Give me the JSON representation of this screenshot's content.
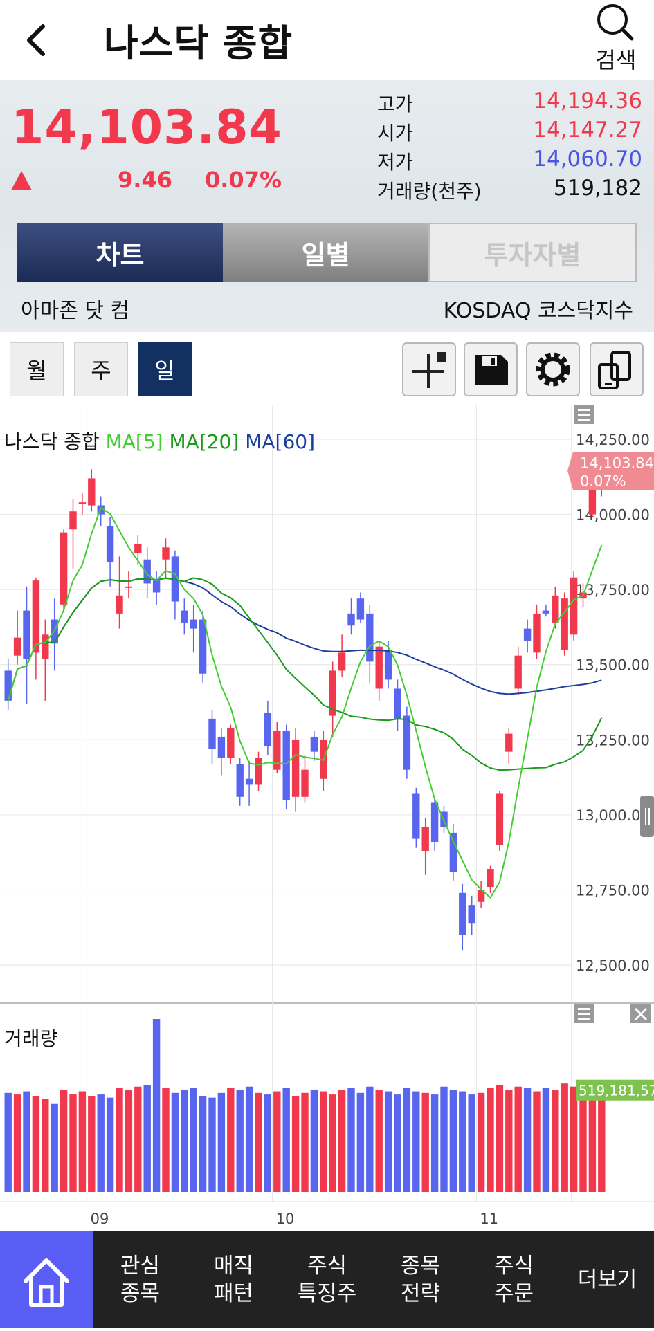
{
  "header": {
    "title": "나스닥 종합",
    "search_label": "검색"
  },
  "quote": {
    "price": "14,103.84",
    "change": "9.46",
    "change_rate": "0.07%",
    "high_label": "고가",
    "high": "14,194.36",
    "open_label": "시가",
    "open": "14,147.27",
    "low_label": "저가",
    "low": "14,060.70",
    "volume_label": "거래량(천주)",
    "volume": "519,182"
  },
  "tabs": [
    {
      "label": "차트"
    },
    {
      "label": "일별"
    },
    {
      "label": "투자자별"
    }
  ],
  "info": {
    "company": "아마존 닷 컴",
    "market": "KOSDAQ 코스닥지수"
  },
  "period_buttons": [
    {
      "label": "월"
    },
    {
      "label": "주"
    },
    {
      "label": "일",
      "active": true
    }
  ],
  "tool_icons": [
    "crosshair-icon",
    "save-icon",
    "gear-icon",
    "rotate-screen-icon"
  ],
  "chart_data": {
    "type": "candlestick",
    "legend": {
      "name": "나스닥 종합",
      "ma": [
        {
          "label": "MA[5]",
          "color": "#44cc33"
        },
        {
          "label": "MA[20]",
          "color": "#1a9a1a"
        },
        {
          "label": "MA[60]",
          "color": "#1a3f9e"
        }
      ]
    },
    "y_ticks": [
      "14,250.00",
      "14,000.00",
      "13,750.00",
      "13,500.00",
      "13,250.00",
      "13,000.00",
      "12,750.00",
      "12,500.00"
    ],
    "y_tick_values": [
      14250,
      14000,
      13750,
      13500,
      13250,
      13000,
      12750,
      12500
    ],
    "ylim": [
      12450,
      14400
    ],
    "x_labels": [
      {
        "label": "09",
        "index": 9
      },
      {
        "label": "10",
        "index": 29
      },
      {
        "label": "11",
        "index": 51
      }
    ],
    "current_price_label": "14,103.84",
    "current_rate_label": "0.07%",
    "up_color": "#f2384c",
    "down_color": "#5865ef",
    "candles": [
      [
        13480,
        13380,
        13520,
        13350
      ],
      [
        13530,
        13590,
        13680,
        13500
      ],
      [
        13680,
        13520,
        13760,
        13370
      ],
      [
        13540,
        13780,
        13790,
        13450
      ],
      [
        13520,
        13600,
        13650,
        13380
      ],
      [
        13650,
        13570,
        13720,
        13480
      ],
      [
        13700,
        13940,
        13950,
        13680
      ],
      [
        13950,
        14010,
        14050,
        13820
      ],
      [
        14040,
        14040,
        14070,
        14000
      ],
      [
        14030,
        14120,
        14150,
        14010
      ],
      [
        14030,
        14000,
        14060,
        13960
      ],
      [
        13960,
        13840,
        13990,
        13760
      ],
      [
        13670,
        13730,
        13860,
        13620
      ],
      [
        13760,
        13760,
        13810,
        13720
      ],
      [
        13870,
        13900,
        13930,
        13830
      ],
      [
        13850,
        13770,
        13890,
        13720
      ],
      [
        13780,
        13740,
        13810,
        13700
      ],
      [
        13850,
        13890,
        13920,
        13790
      ],
      [
        13860,
        13710,
        13880,
        13650
      ],
      [
        13680,
        13640,
        13720,
        13600
      ],
      [
        13650,
        13620,
        13700,
        13540
      ],
      [
        13650,
        13470,
        13680,
        13440
      ],
      [
        13320,
        13220,
        13350,
        13170
      ],
      [
        13260,
        13190,
        13290,
        13130
      ],
      [
        13190,
        13290,
        13300,
        13170
      ],
      [
        13170,
        13060,
        13190,
        13030
      ],
      [
        13120,
        13100,
        13180,
        13030
      ],
      [
        13100,
        13190,
        13210,
        13080
      ],
      [
        13340,
        13230,
        13380,
        13200
      ],
      [
        13150,
        13280,
        13310,
        13140
      ],
      [
        13280,
        13050,
        13300,
        13020
      ],
      [
        13060,
        13250,
        13290,
        13010
      ],
      [
        13060,
        13150,
        13200,
        13040
      ],
      [
        13260,
        13210,
        13280,
        13180
      ],
      [
        13120,
        13250,
        13280,
        13080
      ],
      [
        13330,
        13480,
        13510,
        13260
      ],
      [
        13480,
        13540,
        13600,
        13460
      ],
      [
        13670,
        13630,
        13720,
        13600
      ],
      [
        13720,
        13650,
        13740,
        13640
      ],
      [
        13670,
        13510,
        13700,
        13440
      ],
      [
        13420,
        13560,
        13580,
        13380
      ],
      [
        13550,
        13450,
        13580,
        13420
      ],
      [
        13420,
        13320,
        13450,
        13280
      ],
      [
        13330,
        13150,
        13360,
        13120
      ],
      [
        13070,
        12920,
        13090,
        12890
      ],
      [
        12880,
        12960,
        12990,
        12800
      ],
      [
        13040,
        12910,
        13060,
        12880
      ],
      [
        13010,
        12960,
        13030,
        12940
      ],
      [
        12940,
        12810,
        12970,
        12780
      ],
      [
        12740,
        12600,
        12770,
        12550
      ],
      [
        12700,
        12640,
        12730,
        12600
      ],
      [
        12710,
        12750,
        12780,
        12690
      ],
      [
        12760,
        12820,
        12830,
        12740
      ],
      [
        12900,
        13070,
        13080,
        12880
      ],
      [
        13210,
        13270,
        13290,
        13170
      ],
      [
        13420,
        13530,
        13560,
        13400
      ],
      [
        13620,
        13580,
        13650,
        13540
      ],
      [
        13540,
        13670,
        13700,
        13520
      ],
      [
        13680,
        13670,
        13700,
        13660
      ],
      [
        13640,
        13730,
        13760,
        13620
      ],
      [
        13550,
        13720,
        13740,
        13530
      ],
      [
        13600,
        13790,
        13810,
        13580
      ],
      [
        13720,
        13740,
        13770,
        13690
      ],
      [
        14000,
        14090,
        14110,
        13990
      ],
      [
        14110,
        14150,
        14190,
        14060
      ]
    ],
    "volume_title": "거래량",
    "volume_label": "519,181,57",
    "volume_color": "#7dc34d",
    "volumes": [
      630,
      620,
      640,
      610,
      590,
      560,
      650,
      620,
      640,
      610,
      620,
      600,
      660,
      650,
      670,
      680,
      1100,
      660,
      630,
      650,
      660,
      610,
      600,
      630,
      660,
      650,
      670,
      630,
      620,
      640,
      660,
      610,
      630,
      650,
      640,
      620,
      650,
      660,
      630,
      670,
      650,
      640,
      620,
      660,
      640,
      630,
      620,
      670,
      650,
      640,
      620,
      630,
      660,
      680,
      650,
      670,
      660,
      640,
      660,
      650,
      690,
      670,
      640,
      690,
      670
    ]
  },
  "bottom_nav": [
    {
      "label": "관심\n종목"
    },
    {
      "label": "매직\n패턴"
    },
    {
      "label": "주식\n특징주"
    },
    {
      "label": "종목\n전략"
    },
    {
      "label": "주식\n주문"
    },
    {
      "label": "더보기"
    }
  ]
}
